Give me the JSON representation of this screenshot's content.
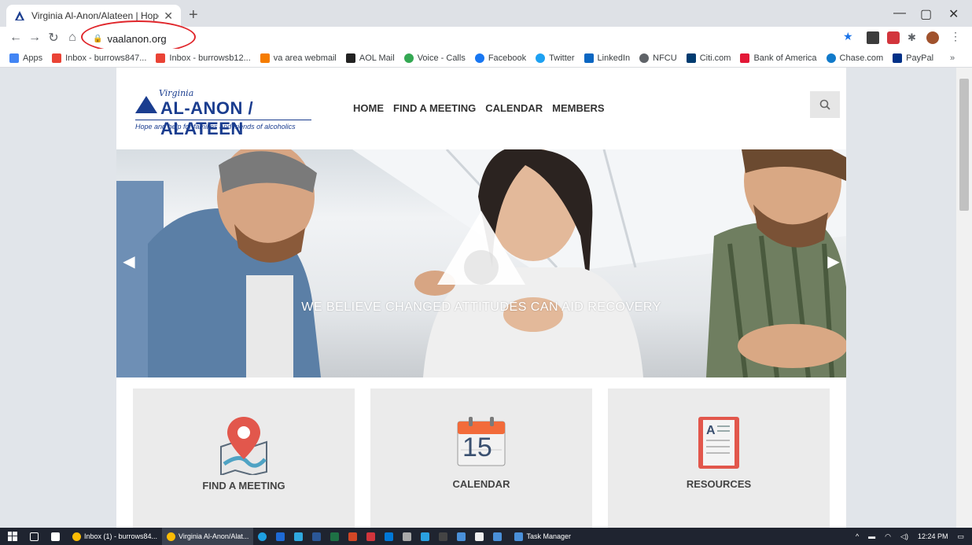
{
  "browser": {
    "tab_title": "Virginia Al-Anon/Alateen | Hope",
    "url": "vaalanon.org",
    "bookmarks": [
      "Apps",
      "Inbox - burrows847...",
      "Inbox - burrowsb12...",
      "va area webmail",
      "AOL Mail",
      "Voice - Calls",
      "Facebook",
      "Twitter",
      "LinkedIn",
      "NFCU",
      "Citi.com",
      "Bank of America",
      "Chase.com",
      "PayPal"
    ],
    "bookmark_overflow": "»"
  },
  "site": {
    "logo_virginia": "Virginia",
    "logo_name": "AL-ANON / ALATEEN",
    "logo_tagline": "Hope and help for families and friends of alcoholics",
    "nav": [
      "HOME",
      "FIND A MEETING",
      "CALENDAR",
      "MEMBERS"
    ],
    "hero_caption": "WE BELIEVE CHANGED ATTITUDES CAN AID RECOVERY",
    "cards": [
      {
        "label": "FIND A MEETING",
        "icon": "map-pin-icon"
      },
      {
        "label": "CALENDAR",
        "icon": "calendar-icon",
        "day": "15"
      },
      {
        "label": "RESOURCES",
        "icon": "book-icon"
      }
    ]
  },
  "taskbar": {
    "items": [
      "Inbox (1) - burrows84...",
      "Virginia Al-Anon/Alat...",
      "Task Manager"
    ],
    "time": "12:24 PM"
  },
  "colors": {
    "brand_blue": "#1a3d8f",
    "highlight_red": "#e0262b",
    "pin_red": "#e2574c",
    "calendar_orange": "#f26b3a"
  }
}
